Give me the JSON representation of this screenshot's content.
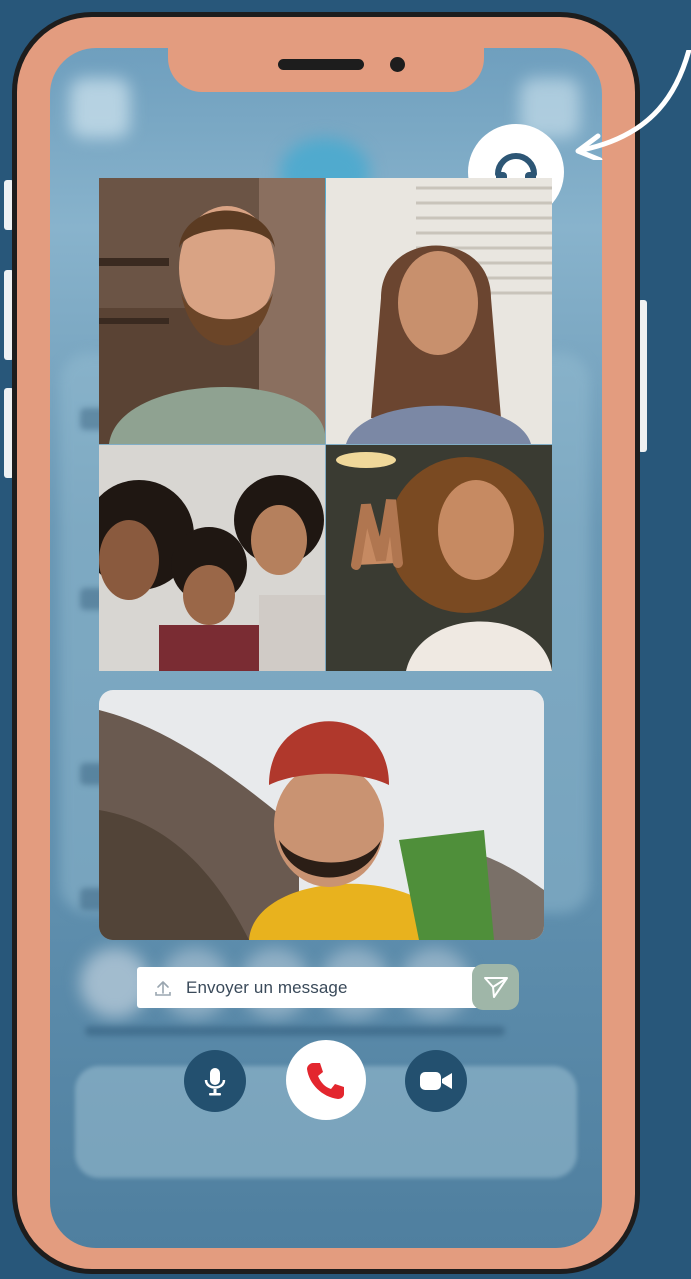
{
  "message_input": {
    "placeholder": "Envoyer un message"
  },
  "icons": {
    "support": "headset-icon",
    "upload": "upload-icon",
    "send": "send-icon",
    "mic": "microphone-icon",
    "hangup": "phone-icon",
    "video": "video-camera-icon"
  },
  "colors": {
    "background": "#28577a",
    "phone_frame": "#e39c7f",
    "control_dark": "#23506f",
    "hangup_red": "#e3262e",
    "send_button": "#9fb6a8"
  },
  "participants": [
    {
      "tile": "top-left"
    },
    {
      "tile": "top-right"
    },
    {
      "tile": "bottom-left"
    },
    {
      "tile": "bottom-right"
    },
    {
      "tile": "self-view"
    }
  ]
}
